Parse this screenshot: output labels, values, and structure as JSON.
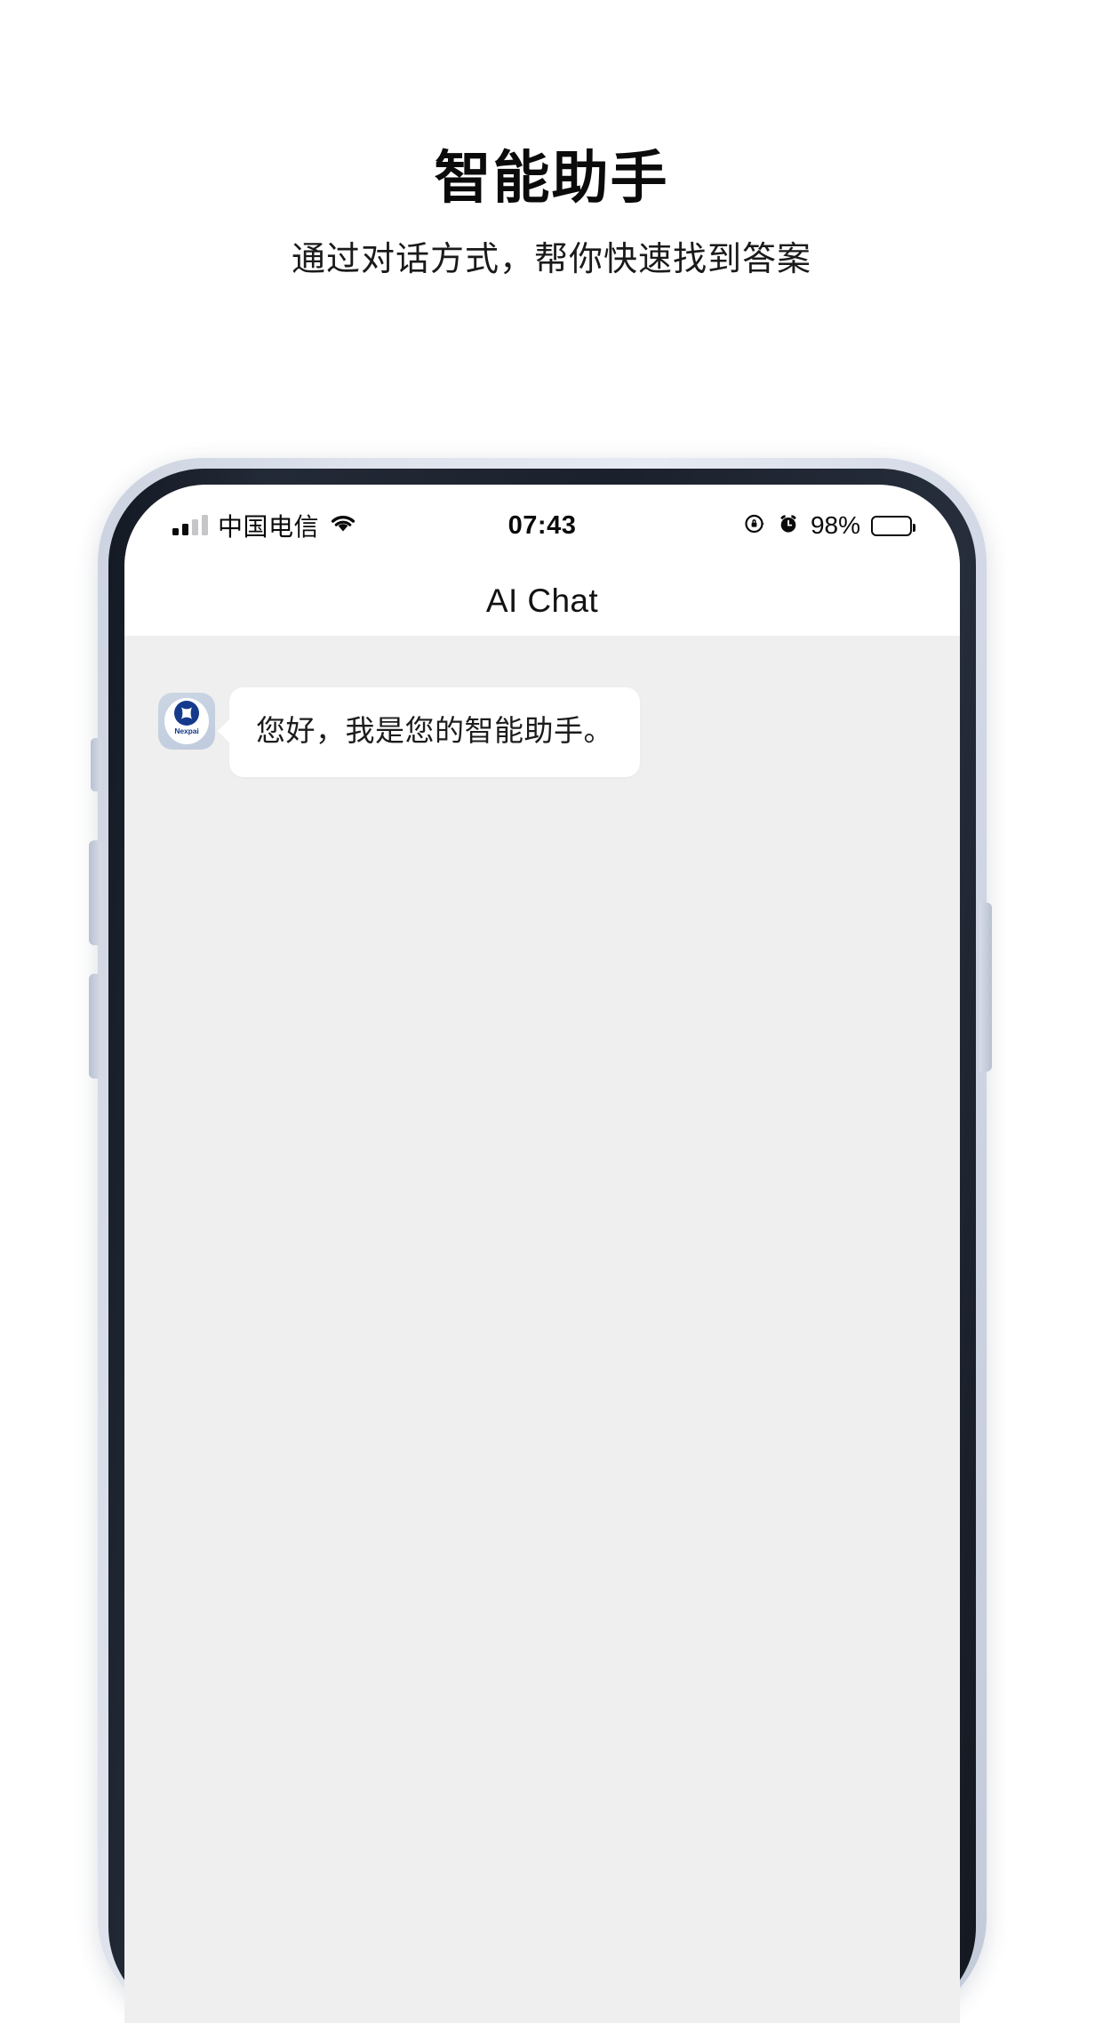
{
  "header": {
    "title": "智能助手",
    "subtitle": "通过对话方式，帮你快速找到答案"
  },
  "phone": {
    "status_bar": {
      "carrier": "中国电信",
      "signal_icon": "signal-bars-icon",
      "wifi_icon": "wifi-icon",
      "time": "07:43",
      "rotation_lock_icon": "rotation-lock-icon",
      "alarm_icon": "alarm-clock-icon",
      "battery_percent": "98%",
      "battery_icon": "battery-full-icon"
    },
    "nav_bar": {
      "title": "AI Chat"
    },
    "chat": {
      "messages": [
        {
          "sender": "assistant",
          "avatar_brand": "Nexpai",
          "avatar_icon": "nexpai-logo-icon",
          "text": "您好，我是您的智能助手。"
        }
      ]
    },
    "hardware": {
      "silent_switch": "silent-switch",
      "volume_up": "volume-up-button",
      "volume_down": "volume-down-button",
      "power": "power-button"
    }
  },
  "colors": {
    "accent": "#143a8c",
    "chat_background": "#efefef",
    "bubble_background": "#ffffff",
    "frame_outer": "#d7dce7",
    "frame_bezel": "#1b212c"
  }
}
